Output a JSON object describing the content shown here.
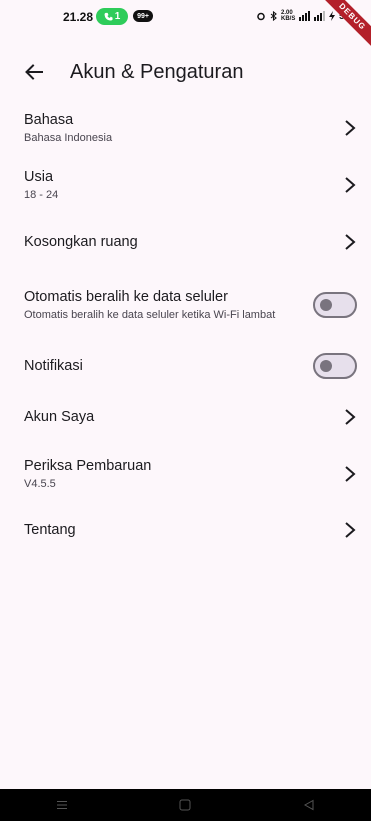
{
  "status_bar": {
    "time": "21.28",
    "pill_text": "1",
    "badge_text": "99+",
    "right_text": "2.00 KB/S",
    "battery": "55%",
    "debug_label": "DEBUG"
  },
  "app_bar": {
    "title": "Akun & Pengaturan"
  },
  "settings": {
    "language": {
      "title": "Bahasa",
      "subtitle": "Bahasa Indonesia"
    },
    "age": {
      "title": "Usia",
      "subtitle": "18 - 24"
    },
    "clear_space": {
      "title": "Kosongkan ruang"
    },
    "auto_switch": {
      "title": "Otomatis beralih ke data seluler",
      "subtitle": "Otomatis beralih ke data seluler ketika Wi-Fi lambat",
      "enabled": false
    },
    "notifications": {
      "title": "Notifikasi",
      "enabled": false
    },
    "my_account": {
      "title": "Akun Saya"
    },
    "check_update": {
      "title": "Periksa Pembaruan",
      "subtitle": "V4.5.5"
    },
    "about": {
      "title": "Tentang"
    }
  },
  "icons": {
    "back": "arrow-left-icon",
    "chevron": "chevron-right-icon",
    "nav_menu": "menu-icon",
    "nav_home": "home-square-icon",
    "nav_back": "back-triangle-icon"
  },
  "colors": {
    "background": "#fdf7fb",
    "text": "#1c1b1f",
    "toggle_off": "#79747e"
  }
}
